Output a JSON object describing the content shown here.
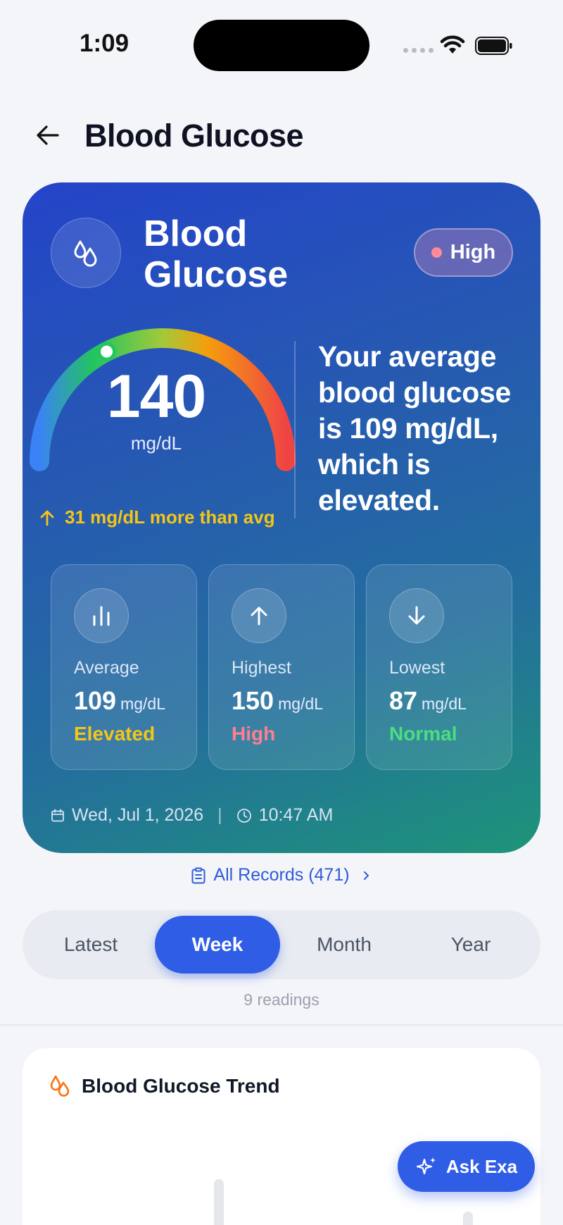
{
  "status_bar": {
    "time": "1:09"
  },
  "header": {
    "title": "Blood Glucose"
  },
  "hero": {
    "title": "Blood Glucose",
    "status": "High",
    "gauge": {
      "value": "140",
      "unit": "mg/dL",
      "level_fraction": 0.35
    },
    "delta": "31 mg/dL more than avg",
    "summary": "Your average blood glucose is 109 mg/dL, which is elevated.",
    "stats": [
      {
        "label": "Average",
        "value": "109",
        "unit": "mg/dL",
        "status": "Elevated",
        "status_color": "#f5c518",
        "icon": "bar-chart-icon"
      },
      {
        "label": "Highest",
        "value": "150",
        "unit": "mg/dL",
        "status": "High",
        "status_color": "#ff7e93",
        "icon": "arrow-up-icon"
      },
      {
        "label": "Lowest",
        "value": "87",
        "unit": "mg/dL",
        "status": "Normal",
        "status_color": "#4ade80",
        "icon": "arrow-down-icon"
      }
    ],
    "date": "Wed, Jul 1, 2026",
    "time": "10:47 AM"
  },
  "records_link": "All Records (471)",
  "tabs": [
    {
      "label": "Latest",
      "active": false
    },
    {
      "label": "Week",
      "active": true
    },
    {
      "label": "Month",
      "active": false
    },
    {
      "label": "Year",
      "active": false
    }
  ],
  "readings_count": "9 readings",
  "trend": {
    "title": "Blood Glucose Trend"
  },
  "ask_button": "Ask Exa",
  "colors": {
    "accent": "#2f5de6",
    "elevated": "#f5c518",
    "high": "#ff7e93",
    "normal": "#4ade80"
  }
}
